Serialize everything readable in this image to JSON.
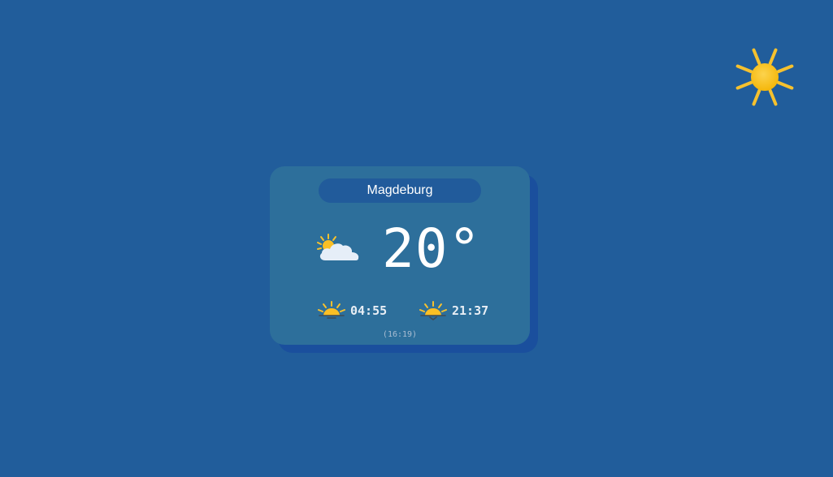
{
  "background_color": "#215d9b",
  "corner_icon": "sun-icon",
  "card": {
    "city": "Magdeburg",
    "weather_icon": "partly-cloudy-icon",
    "temperature": "20°",
    "sunrise": {
      "icon": "sunrise-icon",
      "time": "04:55"
    },
    "sunset": {
      "icon": "sunset-icon",
      "time": "21:37"
    },
    "updated": "(16:19)"
  },
  "colors": {
    "card": "#2d6f9b",
    "card_shadow": "#1a4f9d",
    "city_pill": "#215b9b",
    "sun": "#fbbf24"
  }
}
